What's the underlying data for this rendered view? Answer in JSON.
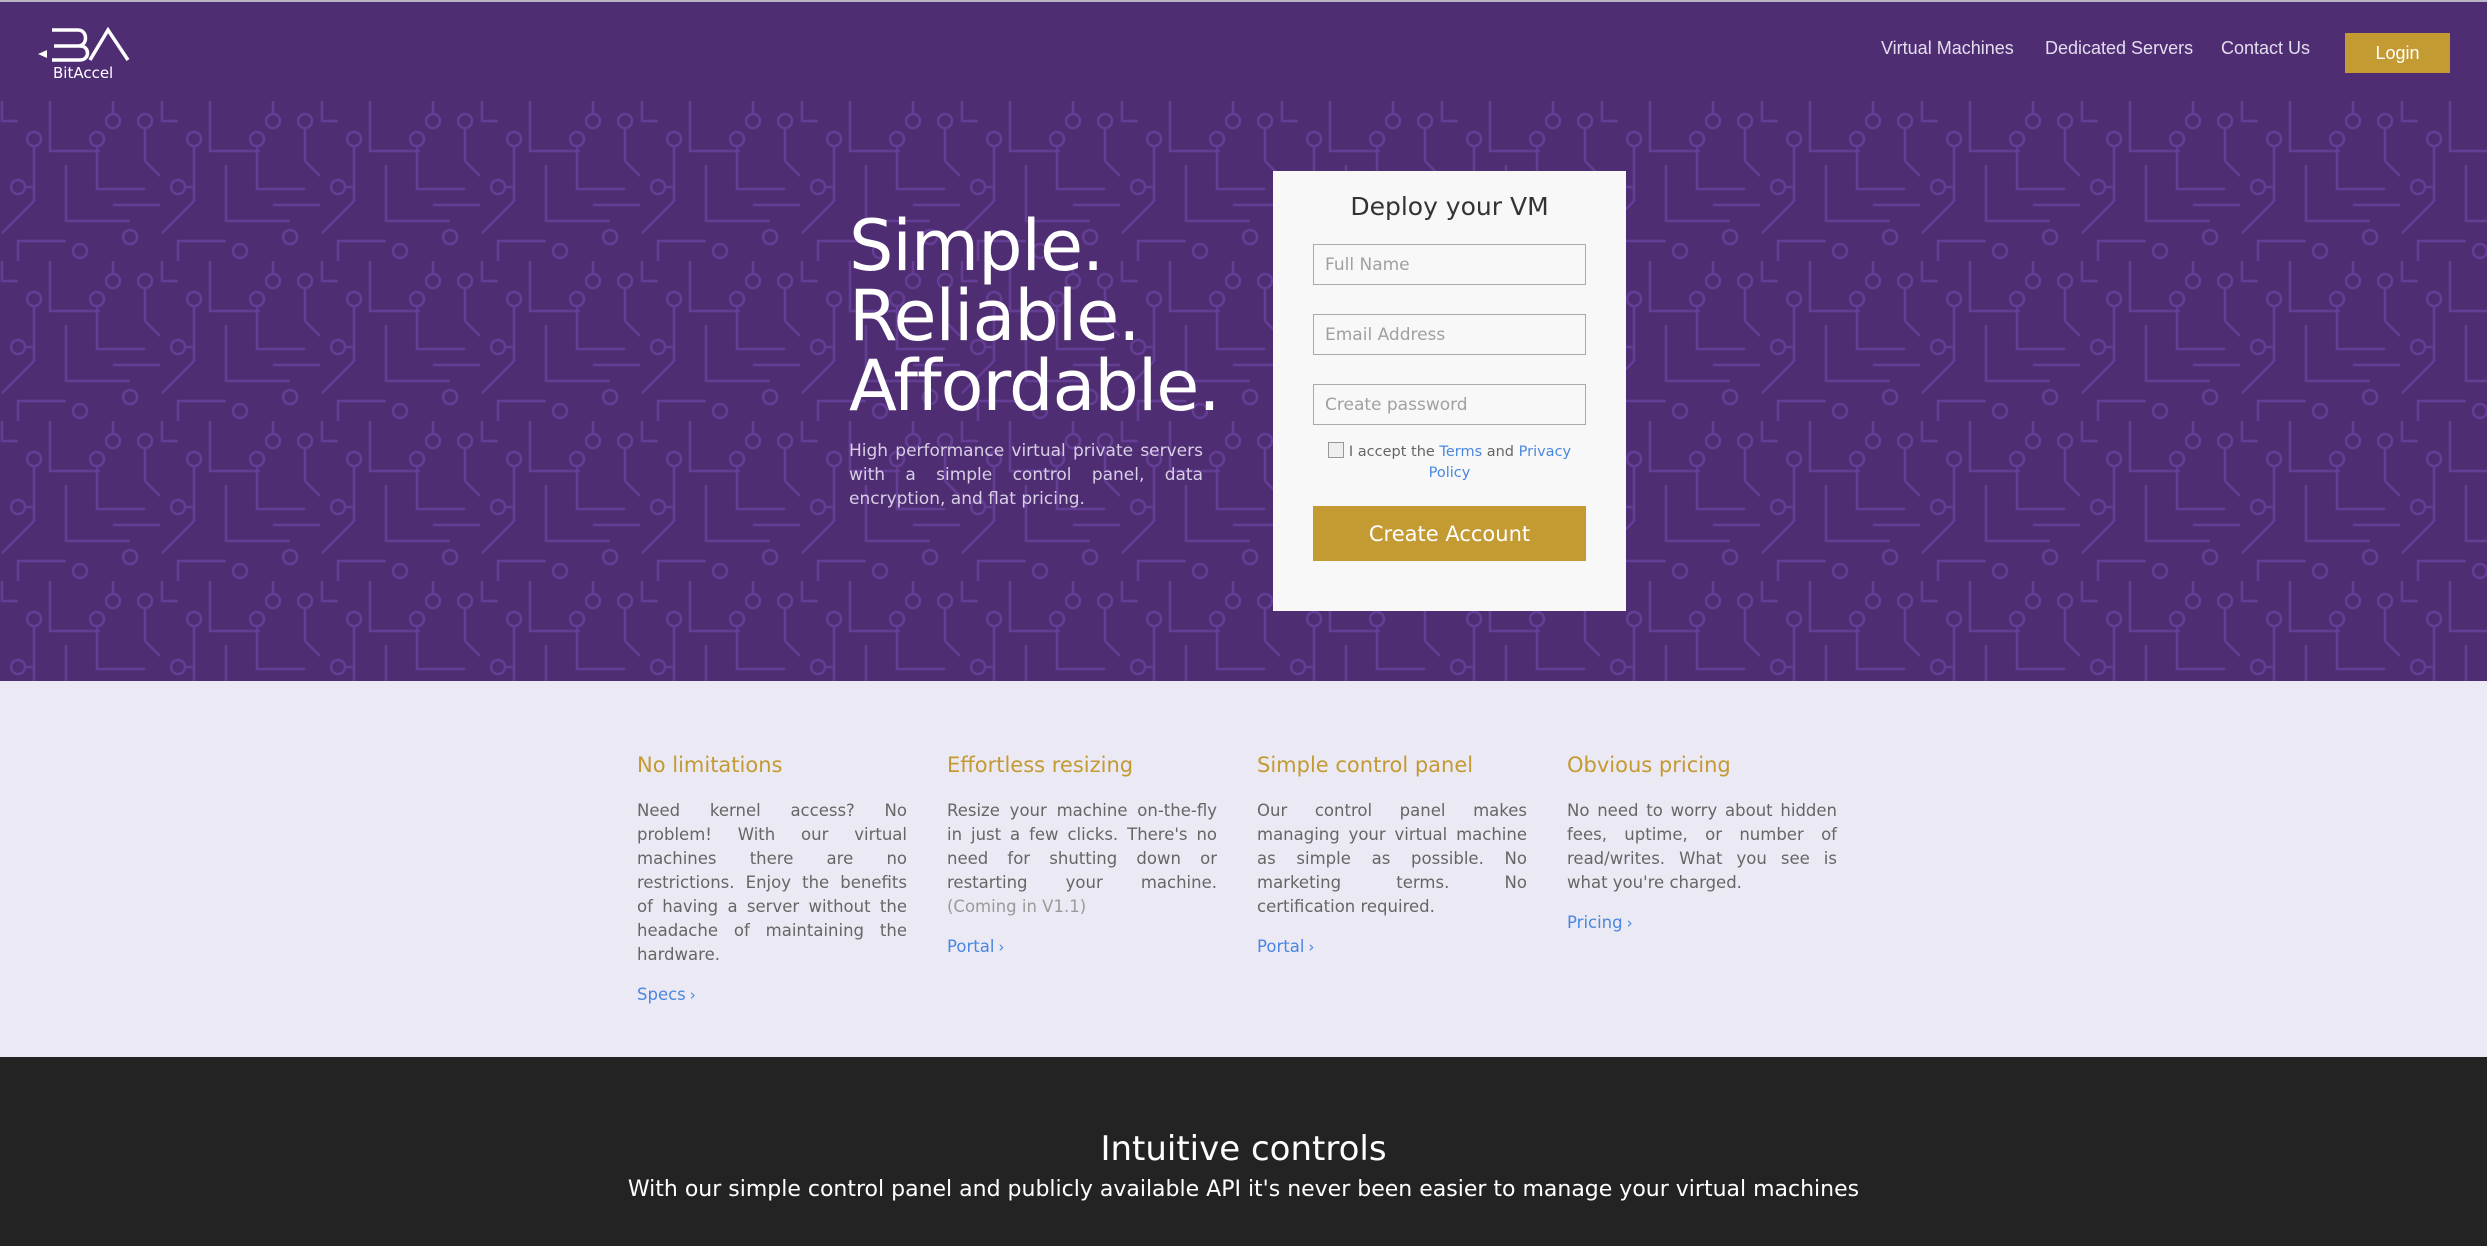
{
  "header": {
    "brand": {
      "name": "BitAccel",
      "mark": "BA"
    },
    "nav": [
      {
        "label": "Virtual Machines"
      },
      {
        "label": "Dedicated Servers"
      },
      {
        "label": "Contact Us"
      }
    ],
    "login_label": "Login"
  },
  "hero": {
    "title_lines": [
      "Simple.",
      "Reliable.",
      "Affordable."
    ],
    "subtitle": "High performance virtual private servers with a simple control panel, data encryption, and flat pricing."
  },
  "signup": {
    "title": "Deploy your VM",
    "fields": {
      "full_name": {
        "placeholder": "Full Name",
        "value": ""
      },
      "email": {
        "placeholder": "Email Address",
        "value": ""
      },
      "password": {
        "placeholder": "Create password",
        "value": ""
      }
    },
    "terms": {
      "checked": false,
      "prefix": "I accept the",
      "terms_link": "Terms",
      "and": "and",
      "privacy_link": "Privacy Policy"
    },
    "submit_label": "Create Account"
  },
  "features": [
    {
      "title": "No limitations",
      "text": "Need kernel access? No problem! With our virtual machines there are no restrictions. Enjoy the benefits of having a server without the headache of maintaining the hardware.",
      "note": "",
      "link": "Specs"
    },
    {
      "title": "Effortless resizing",
      "text": "Resize your machine on-the-fly in just a few clicks. There's no need for shutting down or restarting your machine.",
      "note": "(Coming in V1.1)",
      "link": "Portal"
    },
    {
      "title": "Simple control panel",
      "text": "Our control panel makes managing your virtual machine as simple as possible. No marketing terms. No certification required.",
      "note": "",
      "link": "Portal"
    },
    {
      "title": "Obvious pricing",
      "text": "No need to worry about hidden fees, uptime, or number of read/writes. What you see is what you're charged.",
      "note": "",
      "link": "Pricing"
    }
  ],
  "controls_section": {
    "title": "Intuitive controls",
    "subtitle": "With our simple control panel and publicly available API it's never been easier to manage your virtual machines"
  },
  "colors": {
    "brand_purple": "#4f2d73",
    "accent_gold": "#c49a33",
    "link_blue": "#4a87e0",
    "feature_bg": "#ebe9f3",
    "dark_bg": "#232323"
  }
}
